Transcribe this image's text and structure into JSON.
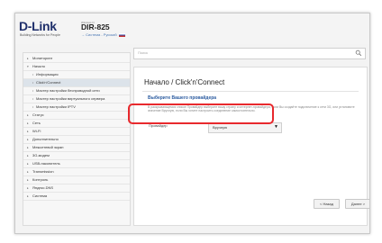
{
  "header": {
    "logo": "D-Link",
    "tagline": "Building Networks for People",
    "model_small": "Wireless N",
    "model": "DIR-825",
    "crumb_arrow": "→",
    "crumbs": "Система - Русский"
  },
  "sidebar": {
    "items": [
      {
        "label": "Мониторинг",
        "arrow": "▸"
      },
      {
        "label": "Начало",
        "arrow": "▾"
      },
      {
        "label": "Информация",
        "arrow": "•"
      },
      {
        "label": "Click'n'Connect",
        "arrow": "•"
      },
      {
        "label": "Мастер настройки беспроводной сети",
        "arrow": "•"
      },
      {
        "label": "Мастер настройки виртуального сервера",
        "arrow": "•"
      },
      {
        "label": "Мастер настройки IPTV",
        "arrow": "•"
      },
      {
        "label": "Статус",
        "arrow": "▸"
      },
      {
        "label": "Сеть",
        "arrow": "▸"
      },
      {
        "label": "Wi-Fi",
        "arrow": "▸"
      },
      {
        "label": "Дополнительно",
        "arrow": "▸"
      },
      {
        "label": "Межсетевой экран",
        "arrow": "▸"
      },
      {
        "label": "3G-модем",
        "arrow": "▸"
      },
      {
        "label": "USB-накопитель",
        "arrow": "▸"
      },
      {
        "label": "Transmission",
        "arrow": "▸"
      },
      {
        "label": "Контроль",
        "arrow": "▸"
      },
      {
        "label": "Яндекс.DNS",
        "arrow": "▸"
      },
      {
        "label": "Система",
        "arrow": "▸"
      }
    ]
  },
  "search": {
    "placeholder": "Поиск"
  },
  "main": {
    "title": "Начало /  Click'n'Connect",
    "section_title": "Выберите Вашего провайдера",
    "description": "В раскрывающемся списке Провайдер выберите вашу страну и интернет-провайдера, если Вы создаёте подключение к сети 3G, или установите значение Вручную, если Вы хотите настроить соединение самостоятельно.",
    "provider_label": "Провайдер",
    "provider_value": "Вручную",
    "chevron": "▼"
  },
  "buttons": {
    "back": "< Назад",
    "next": "Далее >"
  },
  "colors": {
    "highlight": "#e8292d",
    "accent": "#2c5ca0"
  }
}
